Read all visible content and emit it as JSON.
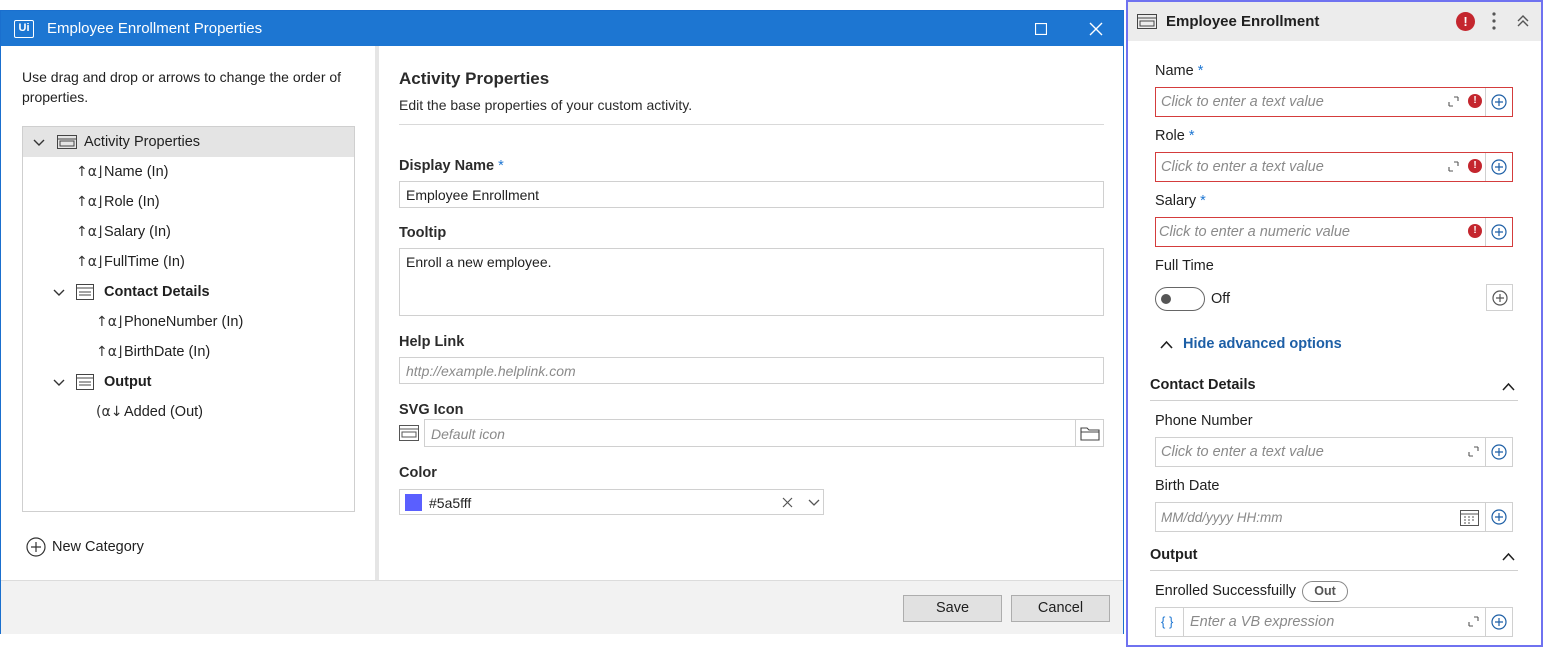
{
  "dialog": {
    "title": "Employee Enrollment Properties",
    "hint": "Use drag and drop or arrows to change the order of properties.",
    "tree": [
      {
        "label": "Activity Properties",
        "kind": "category"
      },
      {
        "label": "Name (In)",
        "kind": "in"
      },
      {
        "label": "Role (In)",
        "kind": "in"
      },
      {
        "label": "Salary (In)",
        "kind": "in"
      },
      {
        "label": "FullTime (In)",
        "kind": "in"
      },
      {
        "label": "Contact Details",
        "kind": "category"
      },
      {
        "label": "PhoneNumber (In)",
        "kind": "in"
      },
      {
        "label": "BirthDate (In)",
        "kind": "in"
      },
      {
        "label": "Output",
        "kind": "category"
      },
      {
        "label": "Added (Out)",
        "kind": "out"
      }
    ],
    "new_category": "New Category",
    "section_title": "Activity Properties",
    "section_subtitle": "Edit the base properties of your custom activity.",
    "display_name_label": "Display Name",
    "display_name_value": "Employee Enrollment",
    "tooltip_label": "Tooltip",
    "tooltip_value": "Enroll a new employee.",
    "help_link_label": "Help Link",
    "help_link_placeholder": "http://example.helplink.com",
    "svg_icon_label": "SVG Icon",
    "svg_icon_placeholder": "Default icon",
    "color_label": "Color",
    "color_value": "#5a5fff",
    "required_mark": "*",
    "save": "Save",
    "cancel": "Cancel"
  },
  "panel": {
    "title": "Employee Enrollment",
    "fields": {
      "name_label": "Name",
      "role_label": "Role",
      "salary_label": "Salary",
      "text_placeholder": "Click to enter a text value",
      "numeric_placeholder": "Click to enter a numeric value",
      "full_time_label": "Full Time",
      "toggle_state": "Off",
      "advanced": "Hide advanced options",
      "contact_section": "Contact Details",
      "phone_label": "Phone Number",
      "birth_label": "Birth Date",
      "date_placeholder": "MM/dd/yyyy HH:mm",
      "output_section": "Output",
      "enrolled_label": "Enrolled Successfuilly",
      "out_badge": "Out",
      "vb_braces": "{ }",
      "vb_placeholder": "Enter a VB expression"
    },
    "required_mark": "*"
  },
  "colors": {
    "titlebar": "#1d76d2",
    "swatch": "#5a5fff",
    "panel_border": "#6f72f0",
    "error": "#c4262e"
  }
}
